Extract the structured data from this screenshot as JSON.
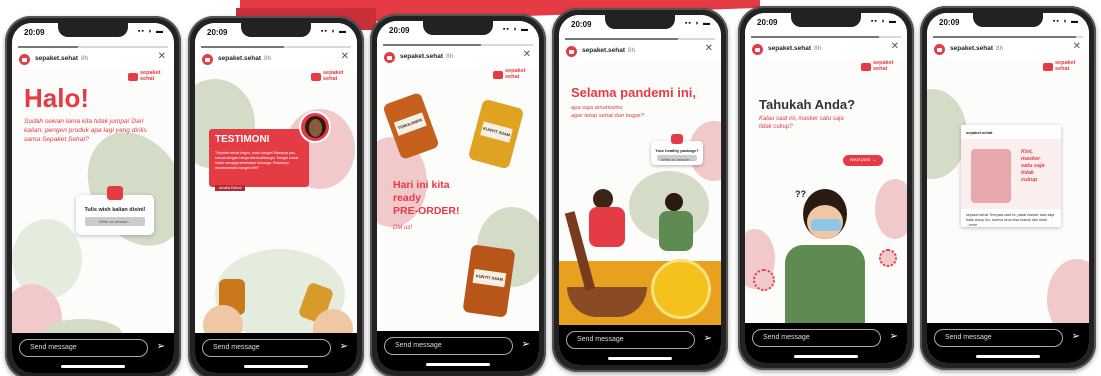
{
  "status": {
    "time": "20:09",
    "icons": "▪▪ ◗ ▬"
  },
  "account": {
    "name": "sepaket.sehat",
    "age": "8h"
  },
  "brand": {
    "line1": "sepaket",
    "line2": "sehat"
  },
  "composer": {
    "placeholder": "Send message"
  },
  "stories": [
    {
      "title": "Halo!",
      "body": "Sudah sekian lama kita tidak jumpa! Dari kalian, pengen produk apa lagi yang dirilis sama Sepaket Sehat?",
      "poll_question": "Tulis wish kalian disini!",
      "poll_button": "Write an answer..."
    },
    {
      "card_title": "TESTIMONI",
      "card_text": "\"Sepaket sehat bagus, enak banget! Rasanya pas, sesuai dengan harga dan kualitasnya. Sangat cocok untuk menjaga kesehatan keluarga. Pokoknya recommended banget deh!\"",
      "card_name": "Amalia Rahmi"
    },
    {
      "label_a": "TEMULAWAK",
      "label_b": "KUNYIT ASAM",
      "headline_1": "Hari ini kita",
      "headline_2": "ready",
      "headline_3": "PRE-ORDER!",
      "cta": "DM us!"
    },
    {
      "title": "Selama pandemi ini,",
      "body_1": "apa saja amunisimu",
      "body_2": "agar tetap sehat dan bugar?",
      "poll_question": "Your healthy package?",
      "poll_button": "Write an answer..."
    },
    {
      "title": "Tahukah Anda?",
      "body_1": "Kalau saat ini, masker satu saja",
      "body_2": "tidak cukup?",
      "next_button": "Next post →",
      "marks": "??"
    },
    {
      "post_account": "sepaket.sehat",
      "post_title_1": "Kini,",
      "post_title_2": "masker",
      "post_title_3": "satu saja",
      "post_title_4": "tidak",
      "post_title_5": "cukup",
      "caption": "sepaket.sehat Ternyata saat ini, pakai masker satu saja tidak cukup lho, karena virus bisa masuk dari celah ...more"
    }
  ],
  "colors": {
    "accent": "#e43b45",
    "pink_blob": "#f2c9cb",
    "green_blob": "#d4dcc8"
  }
}
